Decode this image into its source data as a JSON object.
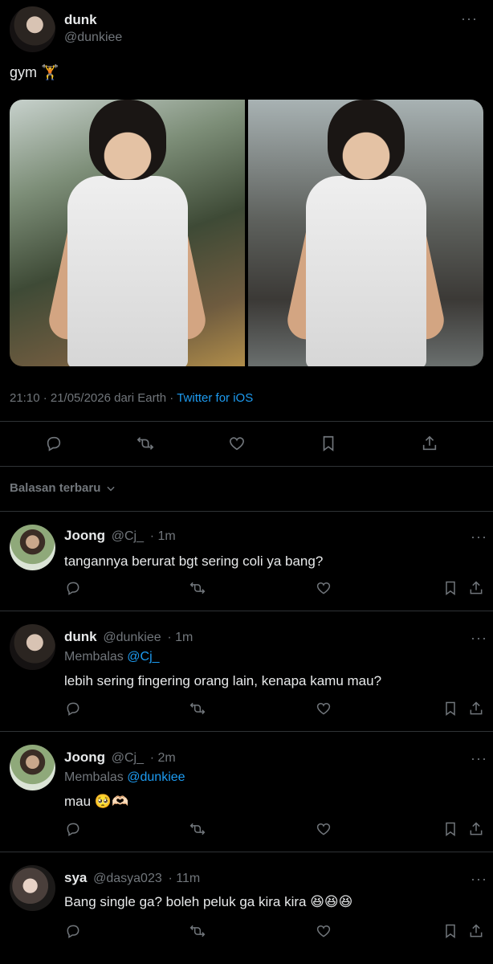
{
  "tweet": {
    "author_name": "dunk",
    "author_handle": "@dunkiee",
    "text": "gym 🏋️",
    "timestamp": "21:10 · 21/05/2026 dari Earth · ",
    "source": "Twitter for iOS",
    "icons": [
      "reply-icon",
      "retweet-icon",
      "like-icon",
      "bookmark-icon",
      "share-icon"
    ]
  },
  "replies_header": {
    "sort_label": "Balasan terbaru"
  },
  "replies": [
    {
      "name": "Joong",
      "handle": "@Cj_",
      "time": "· 1m",
      "replying_prefix": "",
      "replying_to": "",
      "text": "tangannya berurat bgt sering coli ya bang?"
    },
    {
      "name": "dunk",
      "handle": "@dunkiee",
      "time": "· 1m",
      "replying_prefix": "Membalas",
      "replying_to": "@Cj_",
      "text": "lebih sering fingering orang lain, kenapa kamu mau?"
    },
    {
      "name": "Joong",
      "handle": "@Cj_",
      "time": "· 2m",
      "replying_prefix": "Membalas",
      "replying_to": "@dunkiee",
      "text": "mau 🥺🫶🏻"
    },
    {
      "name": "sya",
      "handle": "@dasya023",
      "time": "· 11m",
      "replying_prefix": "",
      "replying_to": "",
      "text": "Bang single ga? boleh peluk ga kira kira 😆😆😆"
    }
  ],
  "colors": {
    "background": "#000000",
    "text": "#e7e9ea",
    "muted": "#71767b",
    "accent": "#1d9bf0",
    "divider": "#2f3336"
  }
}
